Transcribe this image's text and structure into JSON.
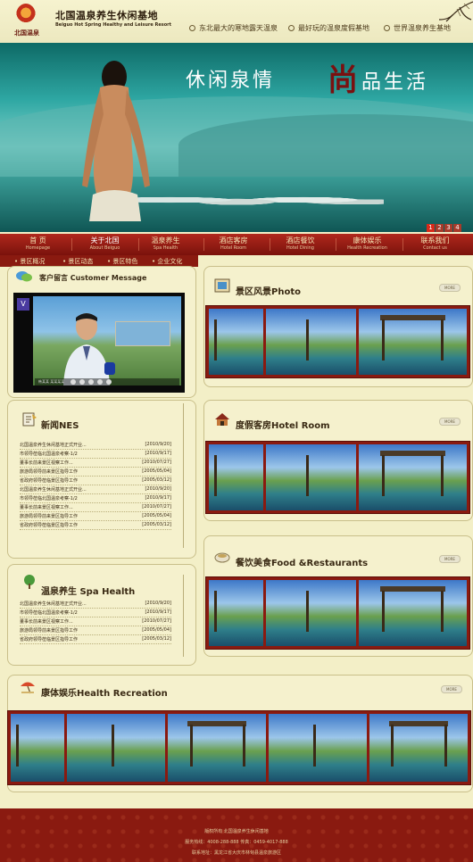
{
  "header": {
    "logo_text": "北国温泉",
    "title": "北国温泉养生休闲基地",
    "subtitle": "Beiguo Hot Spring Healthy and Leisure Resort",
    "slogans": [
      "东北最大的寒地露天温泉",
      "最好玩的温泉度假基地",
      "世界温泉养生基地"
    ]
  },
  "banner": {
    "text_left": "休闲泉情",
    "text_big": "尚",
    "text_right": "品生活",
    "pager": [
      "1",
      "2",
      "3",
      "4"
    ],
    "pager_active": "1"
  },
  "nav": {
    "items": [
      {
        "cn": "首 页",
        "en": "Homepage"
      },
      {
        "cn": "关于北国",
        "en": "About Beiguo"
      },
      {
        "cn": "温泉养生",
        "en": "Spa Health"
      },
      {
        "cn": "酒店客房",
        "en": "Hotel Room"
      },
      {
        "cn": "酒店餐饮",
        "en": "Hotel Dining"
      },
      {
        "cn": "康体娱乐",
        "en": "Health Recreation"
      },
      {
        "cn": "联系我们",
        "en": "Contact us"
      }
    ],
    "active_index": 1
  },
  "subnav": {
    "items": [
      "景区概况",
      "景区动态",
      "景区特色",
      "企业文化"
    ]
  },
  "panels": {
    "message": {
      "title": "客户留言 Customer Message"
    },
    "photo": {
      "title": "景区风景Photo",
      "more": "MORE"
    },
    "news": {
      "title": "新闻NES",
      "rows": [
        {
          "t": "北国温泉养生休闲基地正式开业...",
          "d": "[2010/9/20]"
        },
        {
          "t": "市领导莅临北国温泉考察-1/2",
          "d": "[2010/9/17]"
        },
        {
          "t": "董事长前来景区视察工作...",
          "d": "[2010/07/27]"
        },
        {
          "t": "旅游局领导前来景区指导工作",
          "d": "[2005/05/04]"
        },
        {
          "t": "省政府领导莅临景区指导工作",
          "d": "[2005/03/12]"
        },
        {
          "t": "北国温泉养生休闲基地正式开业...",
          "d": "[2010/9/20]"
        },
        {
          "t": "市领导莅临北国温泉考察-1/2",
          "d": "[2010/9/17]"
        },
        {
          "t": "董事长前来景区视察工作...",
          "d": "[2010/07/27]"
        },
        {
          "t": "旅游局领导前来景区指导工作",
          "d": "[2005/05/04]"
        },
        {
          "t": "省政府领导莅临景区指导工作",
          "d": "[2005/03/12]"
        }
      ]
    },
    "hotel": {
      "title": "度假客房Hotel Room",
      "more": "MORE"
    },
    "spa": {
      "title": "温泉养生 Spa Health",
      "rows": [
        {
          "t": "北国温泉养生休闲基地正式开业...",
          "d": "[2010/9/20]"
        },
        {
          "t": "市领导莅临北国温泉考察-1/2",
          "d": "[2010/9/17]"
        },
        {
          "t": "董事长前来景区视察工作...",
          "d": "[2010/07/27]"
        },
        {
          "t": "旅游局领导前来景区指导工作",
          "d": "[2005/05/04]"
        },
        {
          "t": "省政府领导莅临景区指导工作",
          "d": "[2005/03/12]"
        }
      ]
    },
    "food": {
      "title": "餐饮美食Food &Restaurants",
      "more": "MORE"
    },
    "recreation": {
      "title": "康体娱乐Health Recreation",
      "more": "MORE"
    }
  },
  "video": {
    "channel": "V",
    "caption": "韩某某 某某某某"
  },
  "footer": {
    "line1": "版权所有 北国温泉养生休闲基地",
    "line2": "服务热线：4008-288-888  传真：0459-4017-888",
    "line3": "联系地址：黑龙江省大庆市林甸县温泉旅游区"
  },
  "colors": {
    "page_bg": "#f3efc7",
    "nav_red": "#9a1f14",
    "nav_text": "#f5e6b6"
  }
}
